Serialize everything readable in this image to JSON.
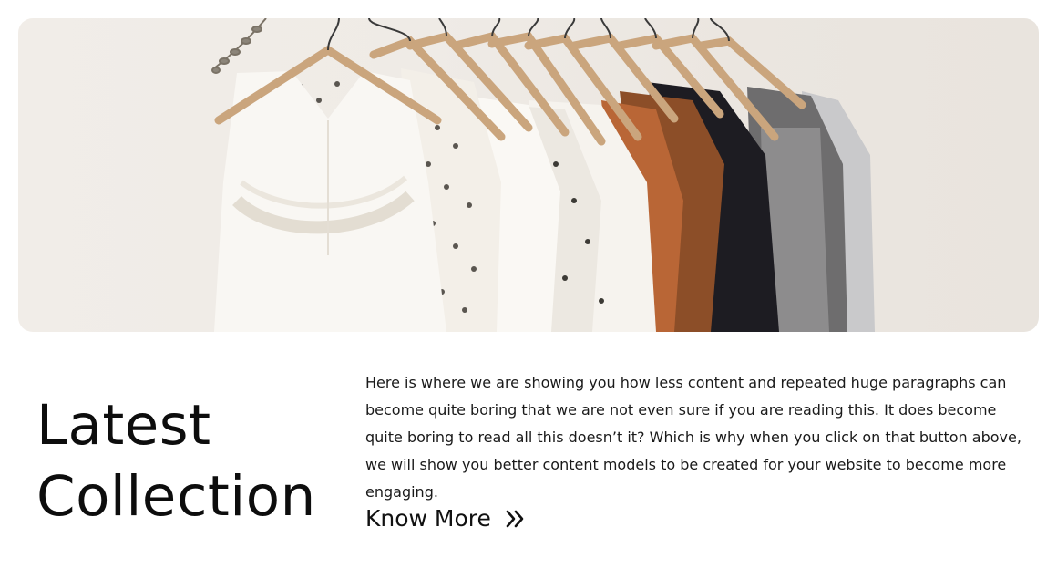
{
  "hero": {
    "image_alt": "Clothes on wooden hangers"
  },
  "section": {
    "heading_line1": "Latest",
    "heading_line2": "Collection",
    "description": "Here is where we are showing you how less content and repeated huge paragraphs can become quite boring that we are not even sure if you are reading this. It does become quite boring to read all this doesn’t it? Which is why when you click on that button above, we will show you better content models to be created for your website to become more engaging.",
    "cta_label": "Know More",
    "cta_icon": "double-chevron-right-icon"
  }
}
